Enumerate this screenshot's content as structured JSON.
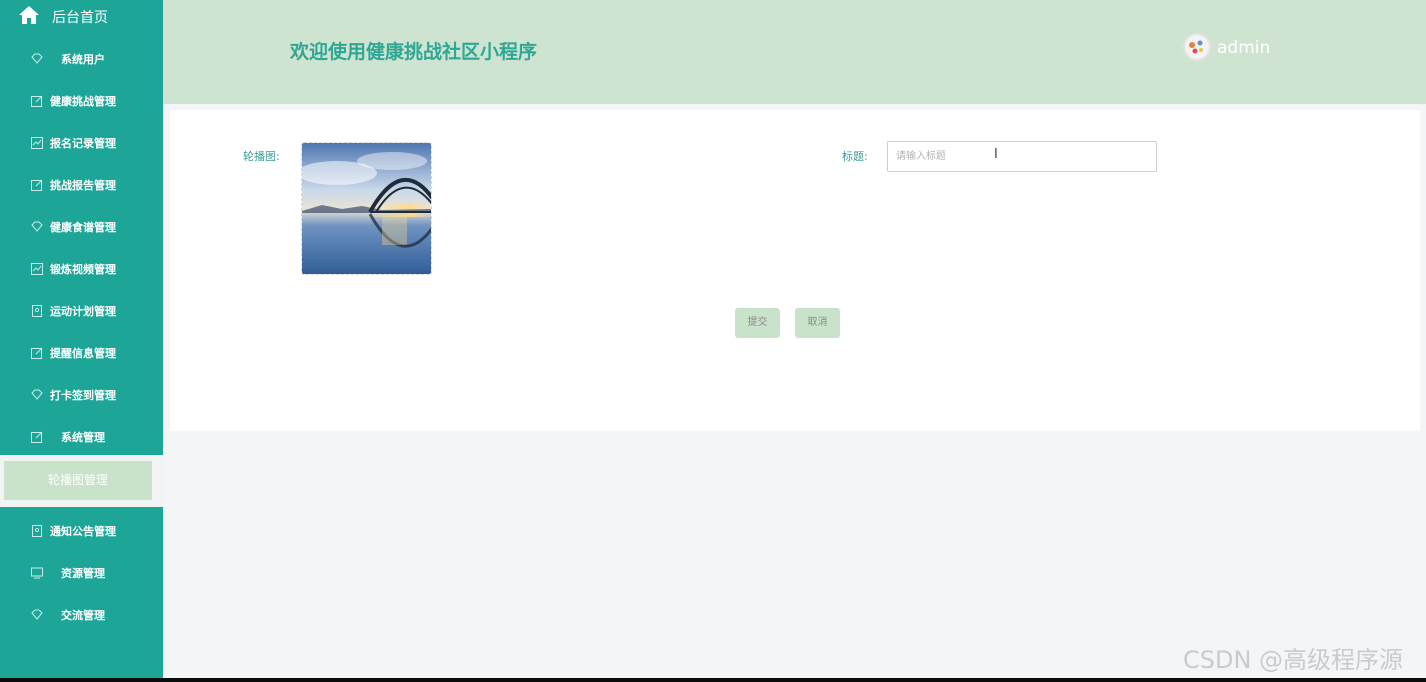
{
  "sidebar": {
    "home_label": "后台首页",
    "items": [
      {
        "label": "系统用户",
        "icon": "diamond-icon"
      },
      {
        "label": "健康挑战管理",
        "icon": "edit-icon"
      },
      {
        "label": "报名记录管理",
        "icon": "chart-icon"
      },
      {
        "label": "挑战报告管理",
        "icon": "edit-icon"
      },
      {
        "label": "健康食谱管理",
        "icon": "diamond-icon"
      },
      {
        "label": "锻炼视频管理",
        "icon": "chart-icon"
      },
      {
        "label": "运动计划管理",
        "icon": "id-card-icon"
      },
      {
        "label": "提醒信息管理",
        "icon": "edit-icon"
      },
      {
        "label": "打卡签到管理",
        "icon": "diamond-icon"
      },
      {
        "label": "系统管理",
        "icon": "edit-icon"
      }
    ],
    "sub_item": "轮播图管理",
    "items_after": [
      {
        "label": "通知公告管理",
        "icon": "id-card-icon"
      },
      {
        "label": "资源管理",
        "icon": "monitor-icon"
      },
      {
        "label": "交流管理",
        "icon": "diamond-icon"
      }
    ]
  },
  "header": {
    "title": "欢迎使用健康挑战社区小程序",
    "username": "admin"
  },
  "form": {
    "carousel_label": "轮播图:",
    "title_label": "标题:",
    "title_placeholder": "请输入标题",
    "title_value": "",
    "submit_label": "提交",
    "cancel_label": "取消"
  },
  "watermark": "CSDN @高级程序源",
  "colors": {
    "sidebar": "#1da597",
    "header": "#cfe4d0",
    "title": "#2ea795",
    "button": "#c9e3ca"
  }
}
